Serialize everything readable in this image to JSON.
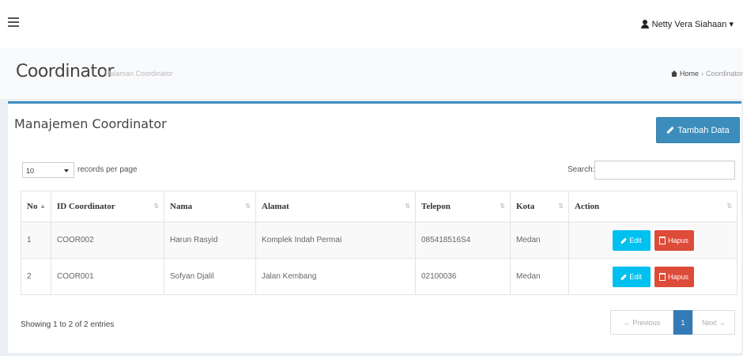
{
  "user": {
    "name": "Netty Vera Siahaan ▾"
  },
  "header": {
    "title": "Coordinator",
    "subtitle": "Halaman Coordinator",
    "breadcrumb_home": "Home",
    "breadcrumb_current": "Coordinator"
  },
  "box": {
    "title": "Manajemen Coordinator",
    "add_button": "Tambah Data"
  },
  "table_controls": {
    "page_length": "10",
    "length_label": "records per page",
    "search_label": "Search:",
    "search_value": ""
  },
  "table": {
    "columns": [
      "No",
      "ID Coordinator",
      "Nama",
      "Alamat",
      "Telepon",
      "Kota",
      "Action"
    ],
    "rows": [
      [
        "1",
        "COOR002",
        "Harun Rasyid",
        "Komplek Indah Permai",
        "085418516S4",
        "Medan"
      ],
      [
        "2",
        "COOR001",
        "Sofyan Djalil",
        "Jalan Kembang",
        "02100036",
        "Medan"
      ]
    ],
    "edit_label": "Edit",
    "delete_label": "Hapus"
  },
  "footer": {
    "info": "Showing 1 to 2 of 2 entries",
    "prev": "← Previous",
    "page": "1",
    "next": "Next →"
  }
}
